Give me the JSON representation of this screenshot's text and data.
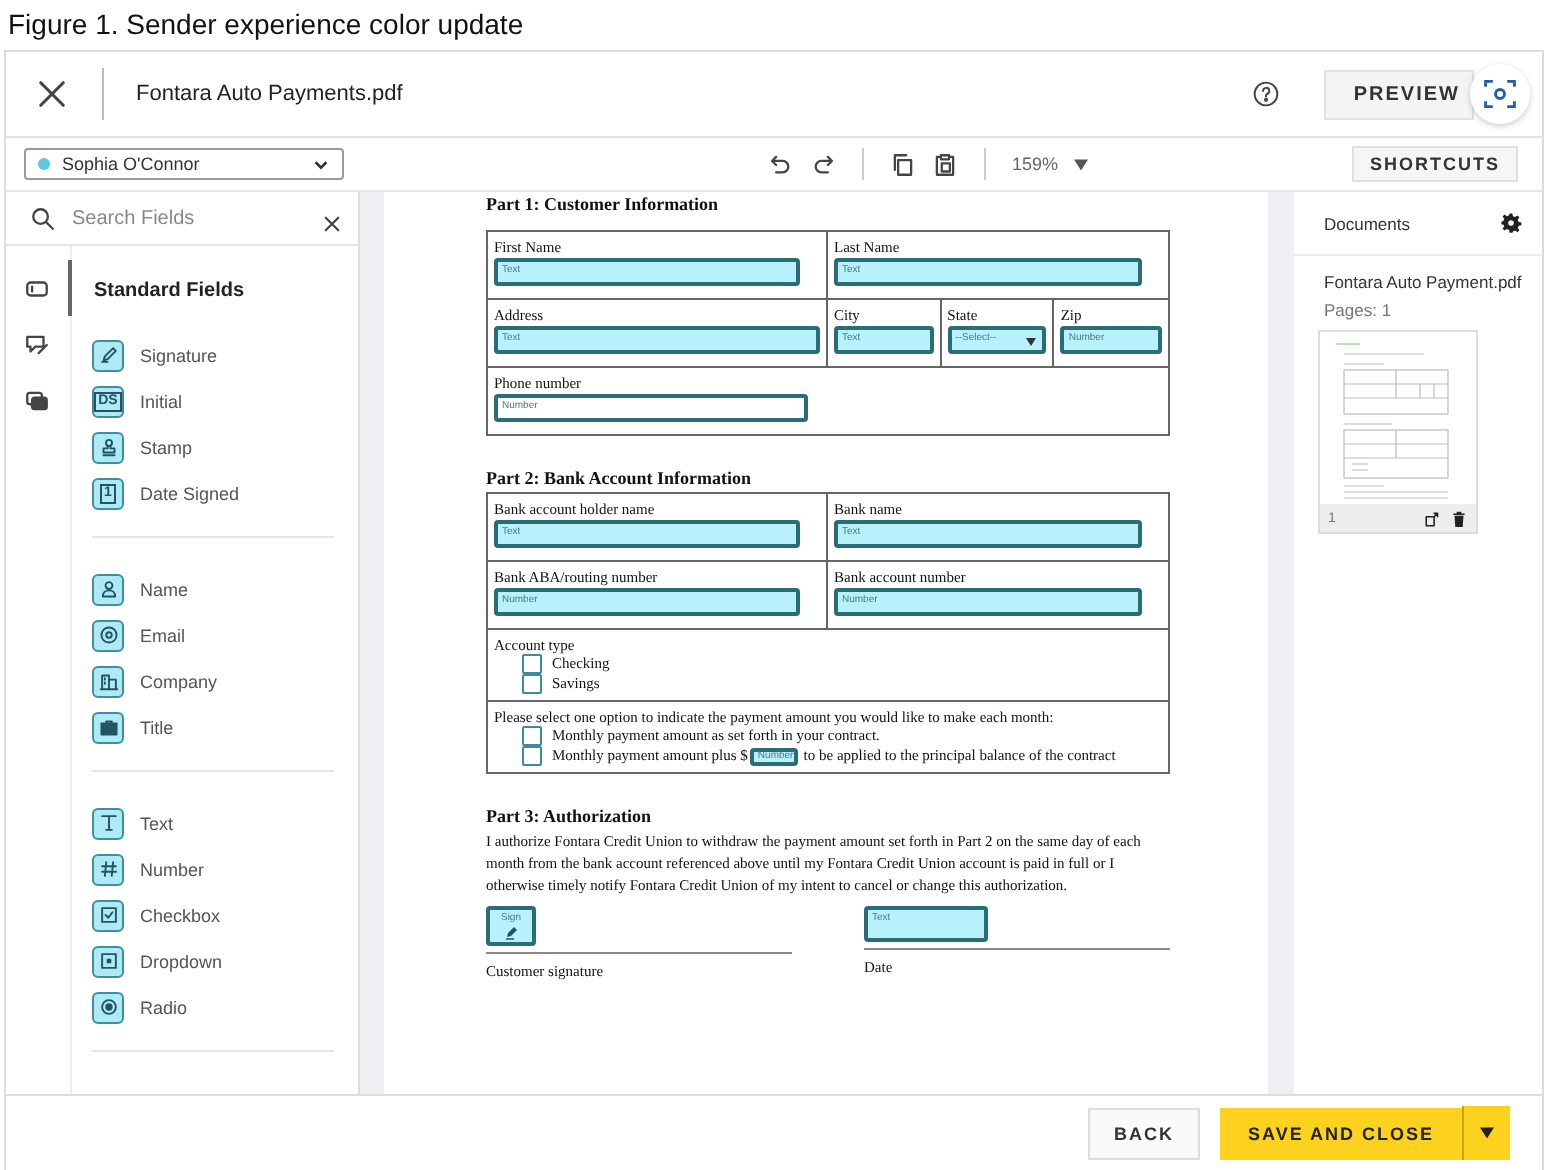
{
  "caption": "Figure 1. Sender experience color update",
  "header": {
    "file_name": "Fontara Auto Payments.pdf",
    "preview_button": "PREVIEW"
  },
  "toolbar": {
    "recipient": "Sophia O'Connor",
    "zoom": "159%",
    "shortcuts_button": "SHORTCUTS"
  },
  "field_panel": {
    "search_placeholder": "Search Fields",
    "rail_tabs": [
      {
        "kind": "fields",
        "selected": true
      },
      {
        "kind": "signing",
        "selected": false
      },
      {
        "kind": "comments",
        "selected": false
      }
    ],
    "title": "Standard Fields",
    "groups": [
      {
        "items": [
          {
            "kind": "signature",
            "label": "Signature"
          },
          {
            "kind": "initial",
            "label": "Initial",
            "glyph": "DS"
          },
          {
            "kind": "stamp",
            "label": "Stamp"
          },
          {
            "kind": "date",
            "label": "Date Signed",
            "glyph": "1"
          }
        ]
      },
      {
        "items": [
          {
            "kind": "name",
            "label": "Name"
          },
          {
            "kind": "email",
            "label": "Email"
          },
          {
            "kind": "company",
            "label": "Company"
          },
          {
            "kind": "title",
            "label": "Title"
          }
        ]
      },
      {
        "items": [
          {
            "kind": "text",
            "label": "Text"
          },
          {
            "kind": "number",
            "label": "Number"
          },
          {
            "kind": "checkbox",
            "label": "Checkbox"
          },
          {
            "kind": "dropdown",
            "label": "Dropdown"
          },
          {
            "kind": "radio",
            "label": "Radio"
          }
        ]
      }
    ]
  },
  "document": {
    "sections": [
      {
        "heading": "Part 1: Customer Information",
        "rows": [
          {
            "cells": [
              {
                "kind": "field",
                "label": "First Name",
                "field": {
                  "kind": "text",
                  "placeholder": "Text",
                  "highlighted": true
                }
              },
              {
                "kind": "field",
                "label": "Last Name",
                "field": {
                  "kind": "text",
                  "placeholder": "Text",
                  "highlighted": true
                }
              }
            ]
          },
          {
            "cells": [
              {
                "kind": "field",
                "label": "Address",
                "field": {
                  "kind": "text",
                  "placeholder": "Text",
                  "highlighted": true
                }
              },
              {
                "kind": "field",
                "label": "City",
                "field": {
                  "kind": "text",
                  "placeholder": "Text",
                  "highlighted": true
                }
              },
              {
                "kind": "field",
                "label": "State",
                "field": {
                  "kind": "select",
                  "placeholder": "--Select--",
                  "highlighted": true
                }
              },
              {
                "kind": "field",
                "label": "Zip",
                "field": {
                  "kind": "number",
                  "placeholder": "Number",
                  "highlighted": true
                }
              }
            ]
          },
          {
            "cells": [
              {
                "kind": "field",
                "label": "Phone number",
                "field": {
                  "kind": "number",
                  "placeholder": "Number",
                  "highlighted": false
                }
              }
            ]
          }
        ]
      },
      {
        "heading": "Part 2: Bank Account Information",
        "rows": [
          {
            "cells": [
              {
                "kind": "field",
                "label": "Bank account holder name",
                "field": {
                  "kind": "text",
                  "placeholder": "Text",
                  "highlighted": true
                }
              },
              {
                "kind": "field",
                "label": "Bank name",
                "field": {
                  "kind": "text",
                  "placeholder": "Text",
                  "highlighted": true
                }
              }
            ]
          },
          {
            "cells": [
              {
                "kind": "field",
                "label": "Bank ABA/routing number",
                "field": {
                  "kind": "number",
                  "placeholder": "Number",
                  "highlighted": true
                }
              },
              {
                "kind": "field",
                "label": "Bank account number",
                "field": {
                  "kind": "number",
                  "placeholder": "Number",
                  "highlighted": true
                }
              }
            ]
          },
          {
            "cells": [
              {
                "kind": "options",
                "label": "Account type",
                "options": [
                  {
                    "text": "Checking",
                    "checked": false
                  },
                  {
                    "text": "Savings",
                    "checked": false
                  }
                ]
              }
            ]
          },
          {
            "cells": [
              {
                "kind": "options",
                "label": "Please select one option to indicate the payment amount you would like to make each month:",
                "options": [
                  {
                    "text": "Monthly payment amount as set forth in your contract.",
                    "checked": false
                  },
                  {
                    "text": "Monthly payment amount plus $",
                    "field": {
                      "kind": "number",
                      "placeholder": "Number",
                      "highlighted": true
                    },
                    "text_after": "to be applied to the principal balance of the contract",
                    "checked": false
                  }
                ]
              }
            ]
          }
        ]
      },
      {
        "heading": "Part 3: Authorization",
        "paragraph": "I authorize Fontara Credit Union to withdraw the payment amount set forth in Part 2 on the same day of each month from the bank account referenced above until my Fontara Credit Union account is paid in full or I otherwise timely notify Fontara Credit Union of my intent to cancel or change this authorization.",
        "signature_lines": [
          {
            "field": {
              "kind": "sign",
              "placeholder": "Sign",
              "highlighted": true
            },
            "label": "Customer signature"
          },
          {
            "field": {
              "kind": "text",
              "placeholder": "Text",
              "highlighted": true
            },
            "label": "Date"
          }
        ]
      }
    ]
  },
  "documents_panel": {
    "title": "Documents",
    "file_name": "Fontara Auto Payment.pdf",
    "pages": "Pages: 1",
    "thumbnail_page": "1"
  },
  "footer": {
    "back_button": "BACK",
    "save_button": "SAVE AND CLOSE"
  }
}
